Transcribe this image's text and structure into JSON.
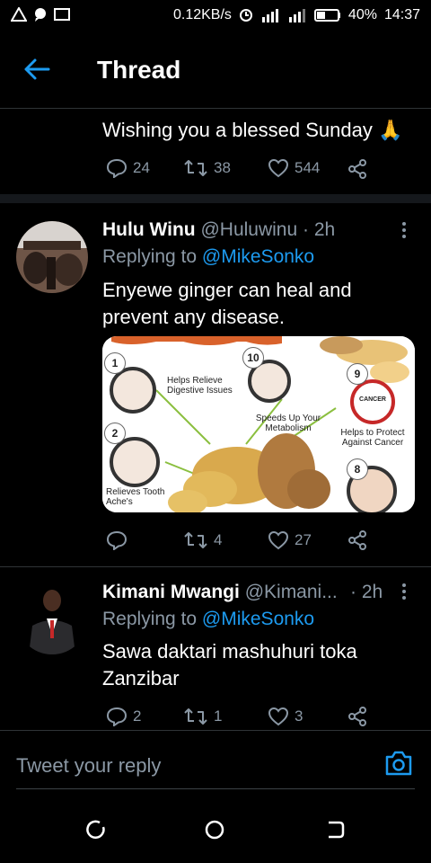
{
  "status_bar": {
    "speed": "0.12KB/s",
    "battery": "40%",
    "time": "14:37"
  },
  "app_bar": {
    "title": "Thread"
  },
  "main_tweet": {
    "text": "Wishing you a blessed Sunday 🙏",
    "replies": "24",
    "retweets": "38",
    "likes": "544"
  },
  "reply1": {
    "name": "Hulu Winu",
    "handle": "@Huluwinu",
    "time": "· 2h",
    "replying_prefix": "Replying to",
    "replying_to": "@MikeSonko",
    "text": "Enyewe ginger can heal and prevent any disease.",
    "replies": "",
    "retweets": "4",
    "likes": "27",
    "image": {
      "labels": {
        "l1": "Helps Relieve Digestive Issues",
        "l10": "Speeds Up Your Metabolism",
        "l9": "Helps to Protect Against Cancer",
        "l2": "Relieves Tooth Ache's"
      },
      "numbers": [
        "1",
        "10",
        "9",
        "2",
        "8"
      ],
      "cancer_sign": "CANCER"
    }
  },
  "reply2": {
    "name": "Kimani Mwangi",
    "handle": "@Kimani...",
    "time": "· 2h",
    "replying_prefix": "Replying to",
    "replying_to": "@MikeSonko",
    "text": "Sawa daktari mashuhuri toka Zanzibar",
    "replies": "2",
    "retweets": "1",
    "likes": "3"
  },
  "compose": {
    "placeholder": "Tweet your reply"
  },
  "colors": {
    "accent": "#1d9bf0",
    "muted": "#8b98a5",
    "background": "#000000"
  },
  "icons": [
    "back-arrow-icon",
    "reply-icon",
    "retweet-icon",
    "like-icon",
    "share-icon",
    "more-icon",
    "camera-icon"
  ]
}
